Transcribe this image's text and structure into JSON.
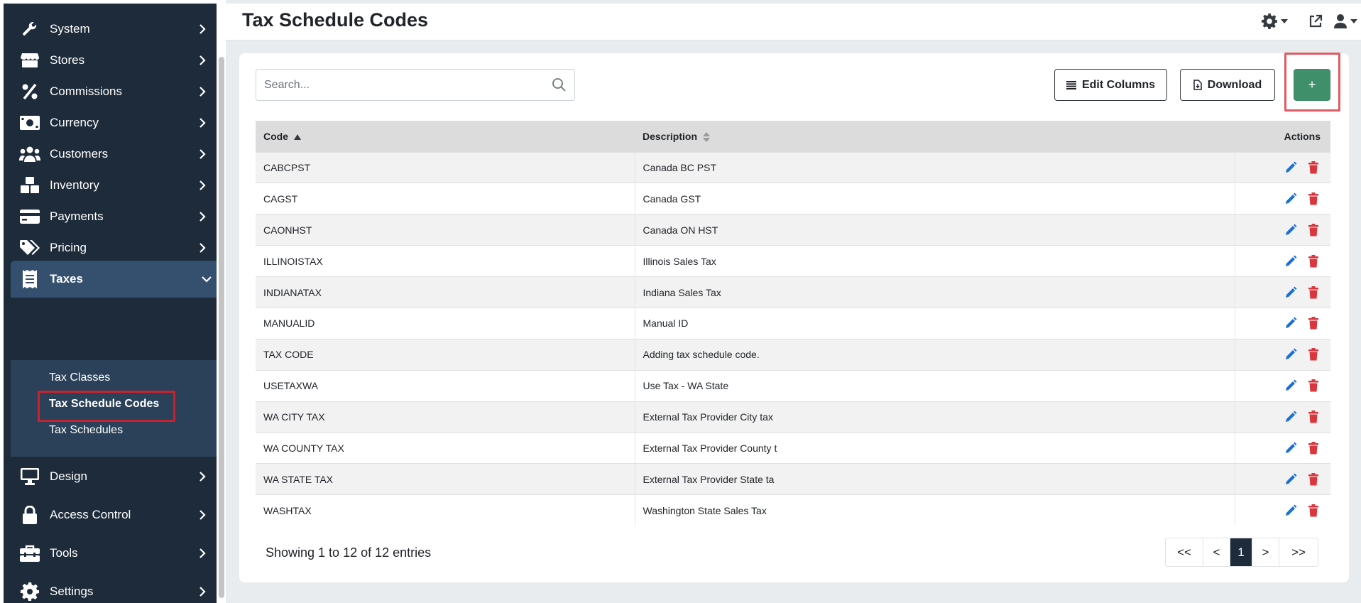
{
  "sidebar": {
    "items": [
      {
        "label": "System",
        "icon": "wrench-icon"
      },
      {
        "label": "Stores",
        "icon": "store-icon"
      },
      {
        "label": "Commissions",
        "icon": "percent-icon"
      },
      {
        "label": "Currency",
        "icon": "money-bill-icon"
      },
      {
        "label": "Customers",
        "icon": "users-icon"
      },
      {
        "label": "Inventory",
        "icon": "boxes-icon"
      },
      {
        "label": "Payments",
        "icon": "credit-card-icon"
      },
      {
        "label": "Pricing",
        "icon": "tags-icon"
      },
      {
        "label": "Taxes",
        "icon": "receipt-icon"
      },
      {
        "label": "Design",
        "icon": "desktop-icon"
      },
      {
        "label": "Access Control",
        "icon": "lock-icon"
      },
      {
        "label": "Tools",
        "icon": "toolbox-icon"
      },
      {
        "label": "Settings",
        "icon": "gear-icon"
      }
    ],
    "taxes_sub": [
      "Tax Classes",
      "Tax Schedule Codes",
      "Tax Schedules"
    ],
    "active_item": "Taxes",
    "current_sub": "Tax Schedule Codes"
  },
  "header": {
    "title": "Tax Schedule Codes"
  },
  "toolbar": {
    "search_placeholder": "Search...",
    "edit_columns_label": "Edit Columns",
    "download_label": "Download",
    "add_label": "+"
  },
  "table": {
    "headers": {
      "code": "Code",
      "description": "Description",
      "actions": "Actions"
    },
    "rows": [
      {
        "code": "CABCPST",
        "description": "Canada BC PST"
      },
      {
        "code": "CAGST",
        "description": "Canada GST"
      },
      {
        "code": "CAONHST",
        "description": "Canada ON HST"
      },
      {
        "code": "ILLINOISTAX",
        "description": "Illinois Sales Tax"
      },
      {
        "code": "INDIANATAX",
        "description": "Indiana Sales Tax"
      },
      {
        "code": "MANUALID",
        "description": "Manual ID"
      },
      {
        "code": "TAX CODE",
        "description": "Adding tax schedule code."
      },
      {
        "code": "USETAXWA",
        "description": "Use Tax - WA State"
      },
      {
        "code": "WA CITY TAX",
        "description": "External Tax Provider City tax"
      },
      {
        "code": "WA COUNTY TAX",
        "description": "External Tax Provider County t"
      },
      {
        "code": "WA STATE TAX",
        "description": "External Tax Provider State ta"
      },
      {
        "code": "WASHTAX",
        "description": "Washington State Sales Tax"
      }
    ]
  },
  "footer": {
    "showing": "Showing 1 to 12 of 12 entries"
  },
  "pagination": {
    "first": "<<",
    "prev": "<",
    "current": "1",
    "next": ">",
    "last": ">>"
  },
  "colors": {
    "sidebar_bg": "#1d2b3a",
    "active_bg": "#34506e",
    "add_button": "#3f8f6b",
    "edit_icon": "#1a6fd6",
    "delete_icon": "#d9363e"
  }
}
